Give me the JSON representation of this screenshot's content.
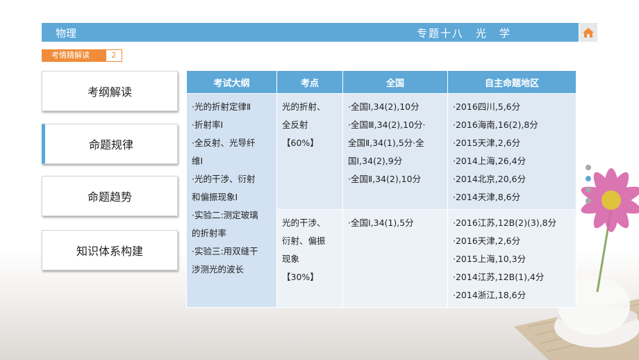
{
  "header": {
    "subject": "物理",
    "chapter": "专题十八　光　学"
  },
  "section_tag": {
    "label": "考情精解读",
    "number": "2"
  },
  "nav": [
    {
      "label": "考纲解读"
    },
    {
      "label": "命题规律"
    },
    {
      "label": "命题趋势"
    },
    {
      "label": "知识体系构建"
    }
  ],
  "table": {
    "headers": [
      "考试大纲",
      "考点",
      "全国",
      "自主命题地区"
    ],
    "syllabus": [
      "·光的折射定律Ⅱ",
      "·折射率Ⅰ",
      "·全反射、光导纤",
      "维Ⅰ",
      "·光的干涉、衍射",
      "和偏振现象Ⅰ",
      "·实验二:测定玻璃",
      "的折射率",
      "·实验三:用双缝干",
      "涉测光的波长"
    ],
    "rows": [
      {
        "point": [
          "光的折射、",
          "全反射",
          "【60%】"
        ],
        "national": [
          "·全国Ⅰ,34(2),10分",
          "·全国Ⅲ,34(2),10分·",
          "全国Ⅱ,34(1),5分·全",
          "国Ⅰ,34(2),9分",
          "·全国Ⅱ,34(2),10分"
        ],
        "regional": [
          "·2016四川,5,6分",
          "·2016海南,16(2),8分",
          "·2015天津,2,6分",
          "·2014上海,26,4分",
          "·2014北京,20,6分",
          "·2014天津,8,6分"
        ]
      },
      {
        "point": [
          "光的干涉、",
          "衍射、偏振",
          "现象",
          "【30%】"
        ],
        "national": [
          "·全国Ⅰ,34(1),5分"
        ],
        "regional": [
          "·2016江苏,12B(2)(3),8分",
          "·2016天津,2,6分",
          "·2015上海,10,3分",
          "·2014江苏,12B(1),4分",
          "·2014浙江,18,6分"
        ]
      }
    ]
  },
  "pager": {
    "count": 4,
    "active": 1
  },
  "colors": {
    "accent": "#5ea8d8",
    "tag": "#f08c3a"
  },
  "icons": {
    "home": "home-icon"
  }
}
